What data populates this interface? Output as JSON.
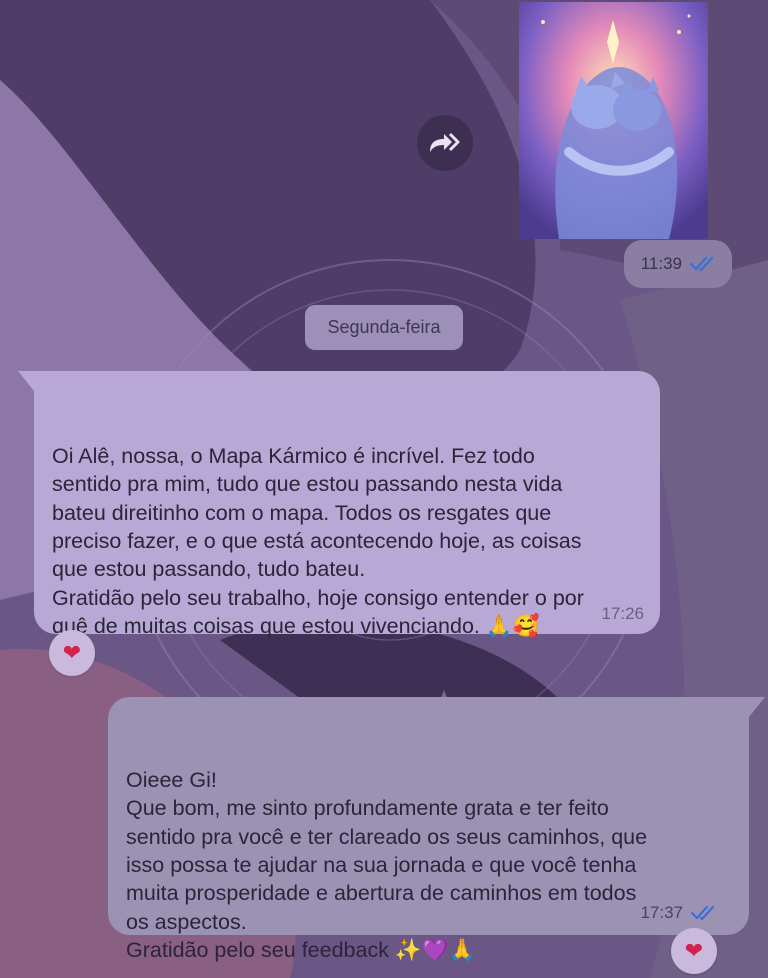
{
  "chat": {
    "image_message": {
      "time": "11:39",
      "status": "read"
    },
    "day_separator": "Segunda-feira",
    "incoming": {
      "text": "Oi Alê, nossa, o Mapa Kármico é incrível. Fez todo\nsentido pra mim, tudo que estou passando nesta vida\nbateu direitinho com o mapa. Todos os resgates que\npreciso fazer, e o que está acontecendo hoje, as coisas\nque estou passando, tudo bateu.\nGratidão pelo seu trabalho, hoje consigo entender o por\nquê de muitas coisas que estou vivenciando. 🙏🥰",
      "time": "17:26",
      "reaction": "❤"
    },
    "outgoing": {
      "text": "Oieee Gi!\nQue bom, me sinto profundamente grata e ter feito\nsentido pra você e ter clareado os seus caminhos, que\nisso possa te ajudar na sua jornada e que você tenha\nmuita prosperidade e abertura de caminhos em todos\nos aspectos.\nGratidão pelo seu feedback ✨💜🙏",
      "time": "17:37",
      "status": "read",
      "reaction": "❤"
    }
  },
  "icons": {
    "forward": "forward-icon",
    "read_receipt": "double-check-icon",
    "reaction_heart": "heart-icon"
  },
  "colors": {
    "read_tick": "#3b6fd4",
    "incoming_bubble": "#b8a8d6",
    "outgoing_bubble": "#9c93b4"
  }
}
